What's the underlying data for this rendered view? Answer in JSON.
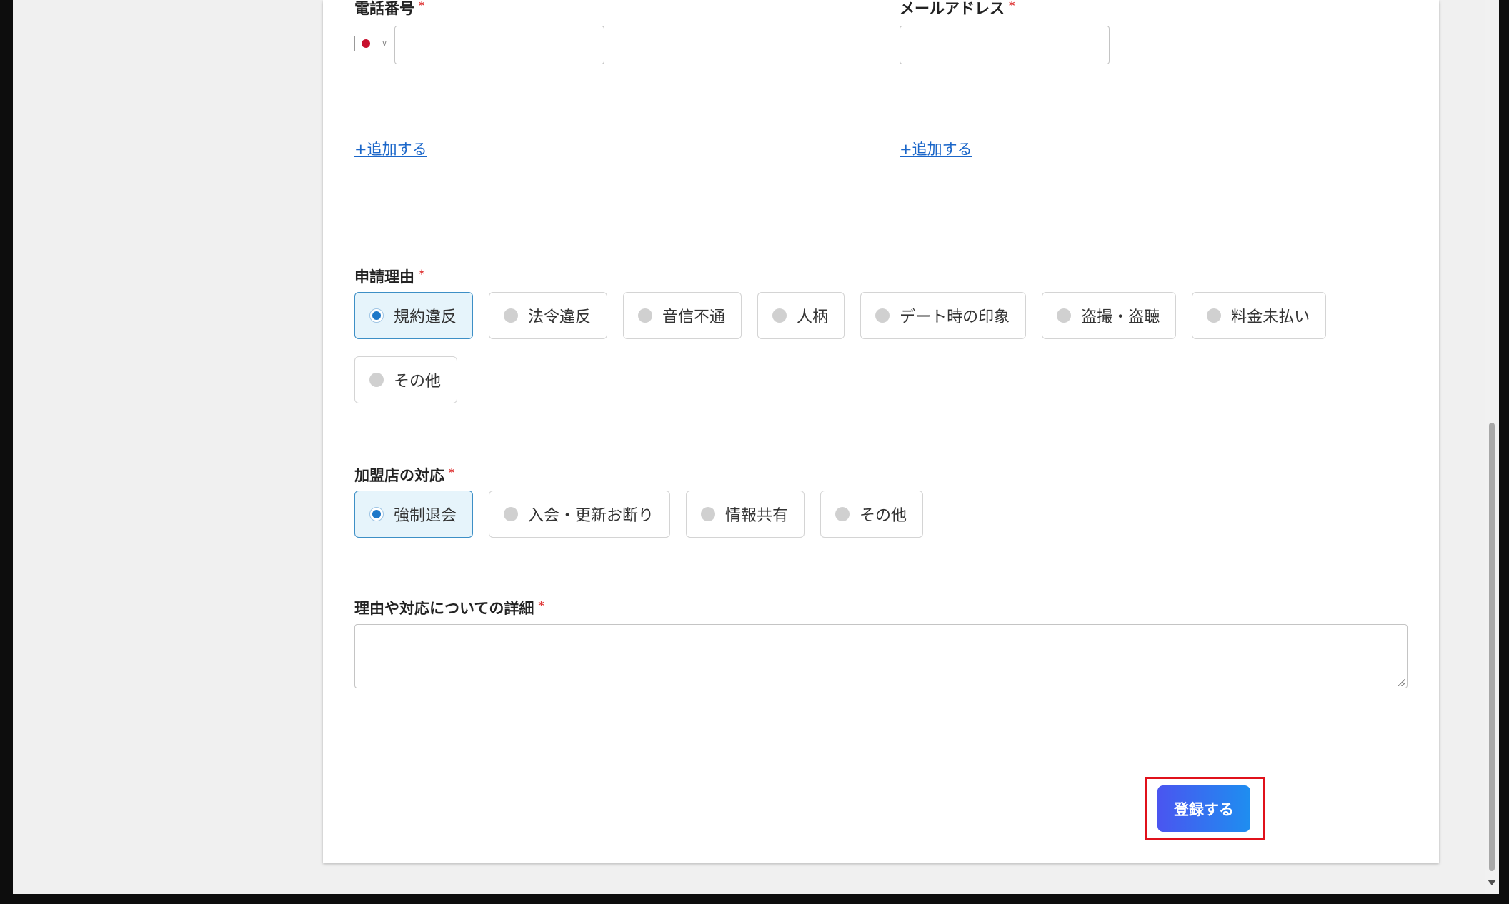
{
  "contact": {
    "phone_label": "電話番号",
    "email_label": "メールアドレス",
    "required_mark": "*",
    "phone_flag": "japan-flag-icon",
    "add_phone_link": "+追加する",
    "add_email_link": "+追加する"
  },
  "reason": {
    "label": "申請理由",
    "required_mark": "*",
    "options": [
      "規約違反",
      "法令違反",
      "音信不通",
      "人柄",
      "デート時の印象",
      "盗撮・盗聴",
      "料金未払い",
      "その他"
    ],
    "selected": "規約違反"
  },
  "response": {
    "label": "加盟店の対応",
    "required_mark": "*",
    "options": [
      "強制退会",
      "入会・更新お断り",
      "情報共有",
      "その他"
    ],
    "selected": "強制退会"
  },
  "details": {
    "label": "理由や対応についての詳細",
    "required_mark": "*",
    "value": ""
  },
  "submit": {
    "label": "登録する"
  },
  "colors": {
    "accent": "#1e78c8",
    "required": "#e03c3c",
    "link": "#1a66c9",
    "highlight": "#e0111b",
    "button_gradient_start": "#4a55f0",
    "button_gradient_end": "#1e8ef0"
  }
}
